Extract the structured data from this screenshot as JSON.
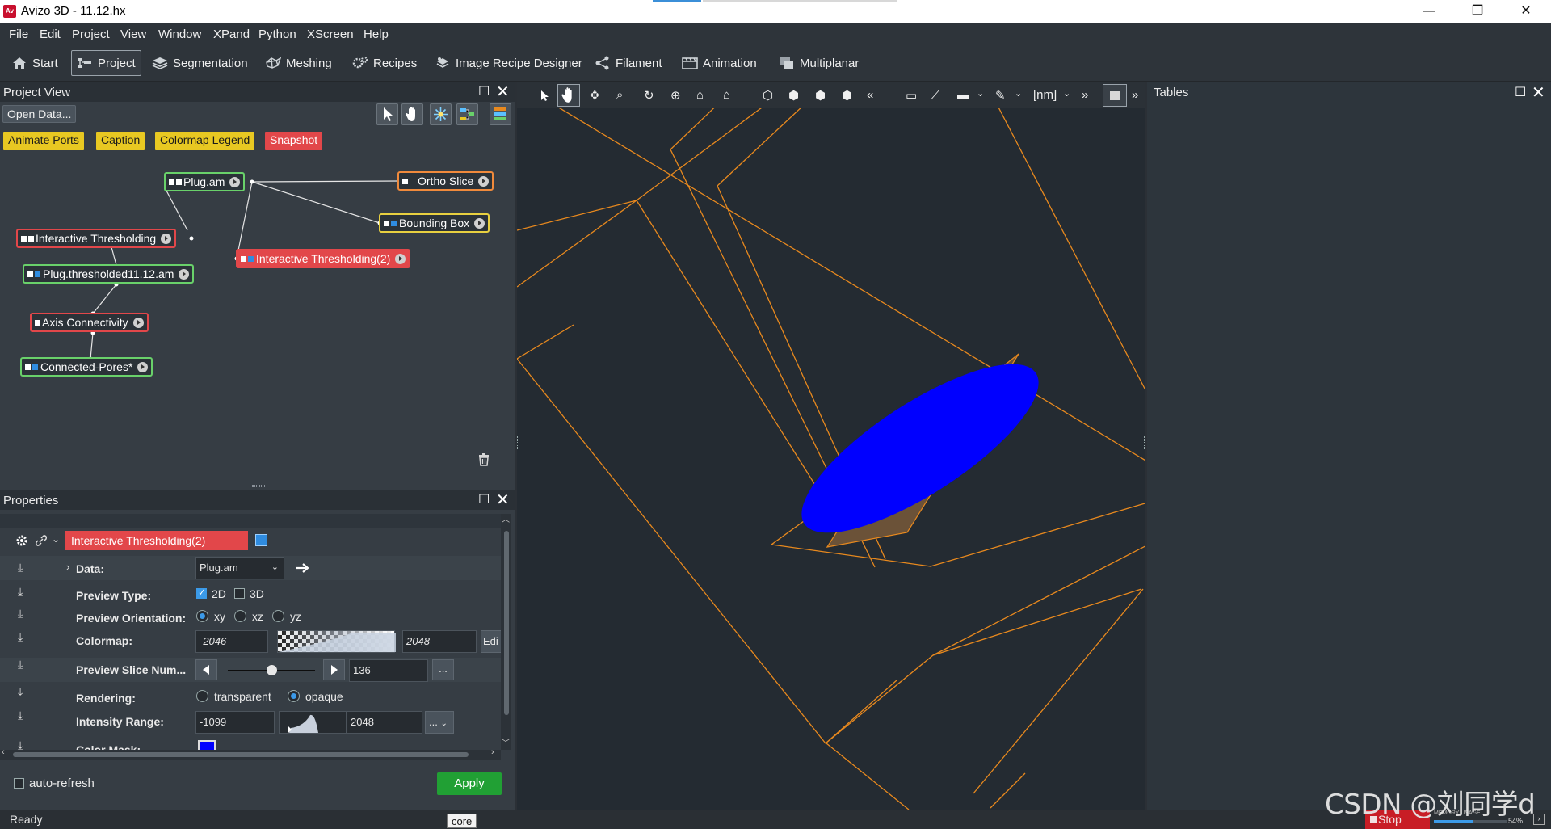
{
  "window": {
    "title": "Avizo 3D - 11.12.hx",
    "logo": "Av",
    "controls": {
      "minimize": "—",
      "restore": "❐",
      "close": "✕"
    }
  },
  "menu": [
    "File",
    "Edit",
    "Project",
    "View",
    "Window",
    "XPand",
    "Python",
    "XScreen",
    "Help"
  ],
  "workrooms": [
    {
      "label": "Start",
      "icon": "home-icon"
    },
    {
      "label": "Project",
      "icon": "project-icon",
      "active": true
    },
    {
      "label": "Segmentation",
      "icon": "layers-icon"
    },
    {
      "label": "Meshing",
      "icon": "mesh-icon"
    },
    {
      "label": "Recipes",
      "icon": "gears-icon"
    },
    {
      "label": "Image Recipe Designer",
      "icon": "recipe-designer-icon"
    },
    {
      "label": "Filament",
      "icon": "filament-icon"
    },
    {
      "label": "Animation",
      "icon": "animation-icon"
    },
    {
      "label": "Multiplanar",
      "icon": "multiplanar-icon"
    }
  ],
  "project_view": {
    "title": "Project View",
    "open_data": "Open Data...",
    "quick_buttons": [
      "Animate Ports",
      "Caption",
      "Colormap Legend",
      "Snapshot"
    ],
    "nodes": {
      "plug_am": "Plug.am",
      "ortho_slice": "Ortho Slice",
      "bounding_box": "Bounding Box",
      "interactive_thresholding": "Interactive Thresholding",
      "interactive_thresholding_2": "Interactive Thresholding(2)",
      "plug_thresholded": "Plug.thresholded11.12.am",
      "axis_connectivity": "Axis Connectivity",
      "connected_pores": "Connected-Pores*"
    }
  },
  "properties": {
    "title": "Properties",
    "module_name": "Interactive Thresholding(2)",
    "module_color": "#2f8ce0",
    "data_label": "Data:",
    "data_value": "Plug.am",
    "preview_type_label": "Preview Type:",
    "preview_type_options": [
      "2D",
      "3D"
    ],
    "preview_orientation_label": "Preview Orientation:",
    "orientation_options": [
      "xy",
      "xz",
      "yz"
    ],
    "colormap_label": "Colormap:",
    "colormap_min": "-2046",
    "colormap_max": "2048",
    "colormap_edit": "Edi",
    "slice_label": "Preview Slice Num...",
    "slice_value": "136",
    "slice_fraction": 0.5,
    "ellipsis": "...",
    "rendering_label": "Rendering:",
    "rendering_options": [
      "transparent",
      "opaque"
    ],
    "intensity_label": "Intensity Range:",
    "intensity_min": "-1099",
    "intensity_max": "2048",
    "color_mask_label": "Color Mask:",
    "color_mask_color": "#0000ff",
    "auto_refresh": "auto-refresh",
    "apply": "Apply"
  },
  "viewer": {
    "unit": "[nm]",
    "overflow": "»",
    "box_color": "#e8891e",
    "ellipse_color": "#0000ff"
  },
  "tables": {
    "title": "Tables"
  },
  "status": {
    "text": "Ready",
    "tooltip": "core",
    "stop": "Stop",
    "memory_label": "MEMORY USAGE",
    "memory_value": "54%",
    "watermark": "CSDN @刘同学d"
  }
}
